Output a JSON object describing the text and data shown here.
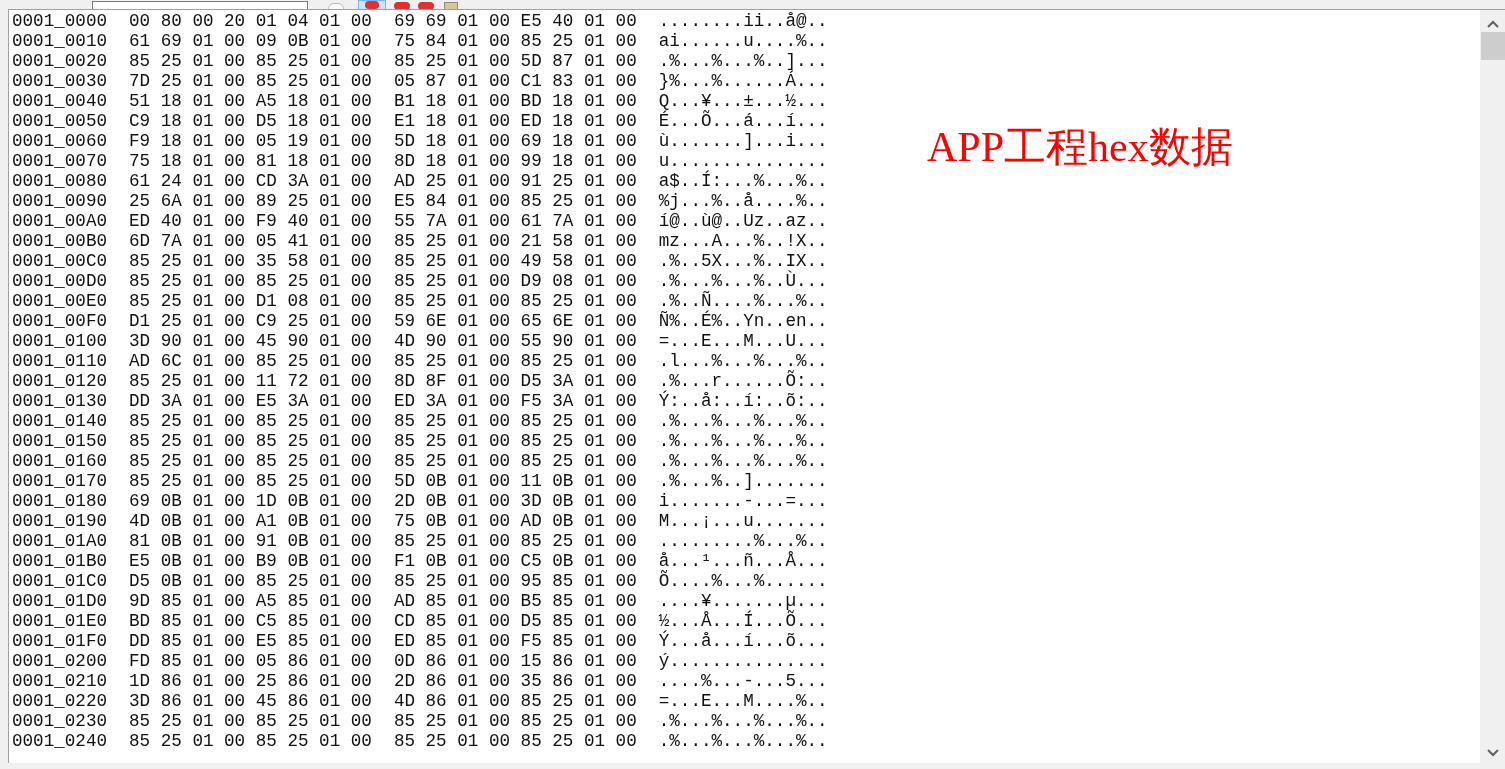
{
  "annotation": "APP工程hex数据",
  "rows": [
    {
      "address": "0001_0000",
      "hex_left": "00 80 00 20 01 04 01 00",
      "hex_right": "69 69 01 00 E5 40 01 00",
      "ascii": "........ii..å@.."
    },
    {
      "address": "0001_0010",
      "hex_left": "61 69 01 00 09 0B 01 00",
      "hex_right": "75 84 01 00 85 25 01 00",
      "ascii": "ai......u....%.."
    },
    {
      "address": "0001_0020",
      "hex_left": "85 25 01 00 85 25 01 00",
      "hex_right": "85 25 01 00 5D 87 01 00",
      "ascii": ".%...%...%..]..."
    },
    {
      "address": "0001_0030",
      "hex_left": "7D 25 01 00 85 25 01 00",
      "hex_right": "05 87 01 00 C1 83 01 00",
      "ascii": "}%...%......Á..."
    },
    {
      "address": "0001_0040",
      "hex_left": "51 18 01 00 A5 18 01 00",
      "hex_right": "B1 18 01 00 BD 18 01 00",
      "ascii": "Q...¥...±...½..."
    },
    {
      "address": "0001_0050",
      "hex_left": "C9 18 01 00 D5 18 01 00",
      "hex_right": "E1 18 01 00 ED 18 01 00",
      "ascii": "É...Õ...á...í..."
    },
    {
      "address": "0001_0060",
      "hex_left": "F9 18 01 00 05 19 01 00",
      "hex_right": "5D 18 01 00 69 18 01 00",
      "ascii": "ù.......]...i..."
    },
    {
      "address": "0001_0070",
      "hex_left": "75 18 01 00 81 18 01 00",
      "hex_right": "8D 18 01 00 99 18 01 00",
      "ascii": "u..............."
    },
    {
      "address": "0001_0080",
      "hex_left": "61 24 01 00 CD 3A 01 00",
      "hex_right": "AD 25 01 00 91 25 01 00",
      "ascii": "a$..Í:...%...%.."
    },
    {
      "address": "0001_0090",
      "hex_left": "25 6A 01 00 89 25 01 00",
      "hex_right": "E5 84 01 00 85 25 01 00",
      "ascii": "%j...%..å....%.."
    },
    {
      "address": "0001_00A0",
      "hex_left": "ED 40 01 00 F9 40 01 00",
      "hex_right": "55 7A 01 00 61 7A 01 00",
      "ascii": "í@..ù@..Uz..az.."
    },
    {
      "address": "0001_00B0",
      "hex_left": "6D 7A 01 00 05 41 01 00",
      "hex_right": "85 25 01 00 21 58 01 00",
      "ascii": "mz...A...%..!X.."
    },
    {
      "address": "0001_00C0",
      "hex_left": "85 25 01 00 35 58 01 00",
      "hex_right": "85 25 01 00 49 58 01 00",
      "ascii": ".%..5X...%..IX.."
    },
    {
      "address": "0001_00D0",
      "hex_left": "85 25 01 00 85 25 01 00",
      "hex_right": "85 25 01 00 D9 08 01 00",
      "ascii": ".%...%...%..Ù..."
    },
    {
      "address": "0001_00E0",
      "hex_left": "85 25 01 00 D1 08 01 00",
      "hex_right": "85 25 01 00 85 25 01 00",
      "ascii": ".%..Ñ....%...%.."
    },
    {
      "address": "0001_00F0",
      "hex_left": "D1 25 01 00 C9 25 01 00",
      "hex_right": "59 6E 01 00 65 6E 01 00",
      "ascii": "Ñ%..É%..Yn..en.."
    },
    {
      "address": "0001_0100",
      "hex_left": "3D 90 01 00 45 90 01 00",
      "hex_right": "4D 90 01 00 55 90 01 00",
      "ascii": "=...E...M...U..."
    },
    {
      "address": "0001_0110",
      "hex_left": "AD 6C 01 00 85 25 01 00",
      "hex_right": "85 25 01 00 85 25 01 00",
      "ascii": ".l...%...%...%.."
    },
    {
      "address": "0001_0120",
      "hex_left": "85 25 01 00 11 72 01 00",
      "hex_right": "8D 8F 01 00 D5 3A 01 00",
      "ascii": ".%...r......Õ:.."
    },
    {
      "address": "0001_0130",
      "hex_left": "DD 3A 01 00 E5 3A 01 00",
      "hex_right": "ED 3A 01 00 F5 3A 01 00",
      "ascii": "Ý:..å:..í:..õ:.."
    },
    {
      "address": "0001_0140",
      "hex_left": "85 25 01 00 85 25 01 00",
      "hex_right": "85 25 01 00 85 25 01 00",
      "ascii": ".%...%...%...%.."
    },
    {
      "address": "0001_0150",
      "hex_left": "85 25 01 00 85 25 01 00",
      "hex_right": "85 25 01 00 85 25 01 00",
      "ascii": ".%...%...%...%.."
    },
    {
      "address": "0001_0160",
      "hex_left": "85 25 01 00 85 25 01 00",
      "hex_right": "85 25 01 00 85 25 01 00",
      "ascii": ".%...%...%...%.."
    },
    {
      "address": "0001_0170",
      "hex_left": "85 25 01 00 85 25 01 00",
      "hex_right": "5D 0B 01 00 11 0B 01 00",
      "ascii": ".%...%..]......."
    },
    {
      "address": "0001_0180",
      "hex_left": "69 0B 01 00 1D 0B 01 00",
      "hex_right": "2D 0B 01 00 3D 0B 01 00",
      "ascii": "i.......-...=..."
    },
    {
      "address": "0001_0190",
      "hex_left": "4D 0B 01 00 A1 0B 01 00",
      "hex_right": "75 0B 01 00 AD 0B 01 00",
      "ascii": "M...¡...u......."
    },
    {
      "address": "0001_01A0",
      "hex_left": "81 0B 01 00 91 0B 01 00",
      "hex_right": "85 25 01 00 85 25 01 00",
      "ascii": ".........%...%.."
    },
    {
      "address": "0001_01B0",
      "hex_left": "E5 0B 01 00 B9 0B 01 00",
      "hex_right": "F1 0B 01 00 C5 0B 01 00",
      "ascii": "å...¹...ñ...Å..."
    },
    {
      "address": "0001_01C0",
      "hex_left": "D5 0B 01 00 85 25 01 00",
      "hex_right": "85 25 01 00 95 85 01 00",
      "ascii": "Õ....%...%......"
    },
    {
      "address": "0001_01D0",
      "hex_left": "9D 85 01 00 A5 85 01 00",
      "hex_right": "AD 85 01 00 B5 85 01 00",
      "ascii": "....¥.......µ..."
    },
    {
      "address": "0001_01E0",
      "hex_left": "BD 85 01 00 C5 85 01 00",
      "hex_right": "CD 85 01 00 D5 85 01 00",
      "ascii": "½...Å...Í...Õ..."
    },
    {
      "address": "0001_01F0",
      "hex_left": "DD 85 01 00 E5 85 01 00",
      "hex_right": "ED 85 01 00 F5 85 01 00",
      "ascii": "Ý...å...í...õ..."
    },
    {
      "address": "0001_0200",
      "hex_left": "FD 85 01 00 05 86 01 00",
      "hex_right": "0D 86 01 00 15 86 01 00",
      "ascii": "ý..............."
    },
    {
      "address": "0001_0210",
      "hex_left": "1D 86 01 00 25 86 01 00",
      "hex_right": "2D 86 01 00 35 86 01 00",
      "ascii": "....%...-...5..."
    },
    {
      "address": "0001_0220",
      "hex_left": "3D 86 01 00 45 86 01 00",
      "hex_right": "4D 86 01 00 85 25 01 00",
      "ascii": "=...E...M....%.."
    },
    {
      "address": "0001_0230",
      "hex_left": "85 25 01 00 85 25 01 00",
      "hex_right": "85 25 01 00 85 25 01 00",
      "ascii": ".%...%...%...%.."
    },
    {
      "address": "0001_0240",
      "hex_left": "85 25 01 00 85 25 01 00",
      "hex_right": "85 25 01 00 85 25 01 00",
      "ascii": ".%...%...%...%.."
    }
  ]
}
